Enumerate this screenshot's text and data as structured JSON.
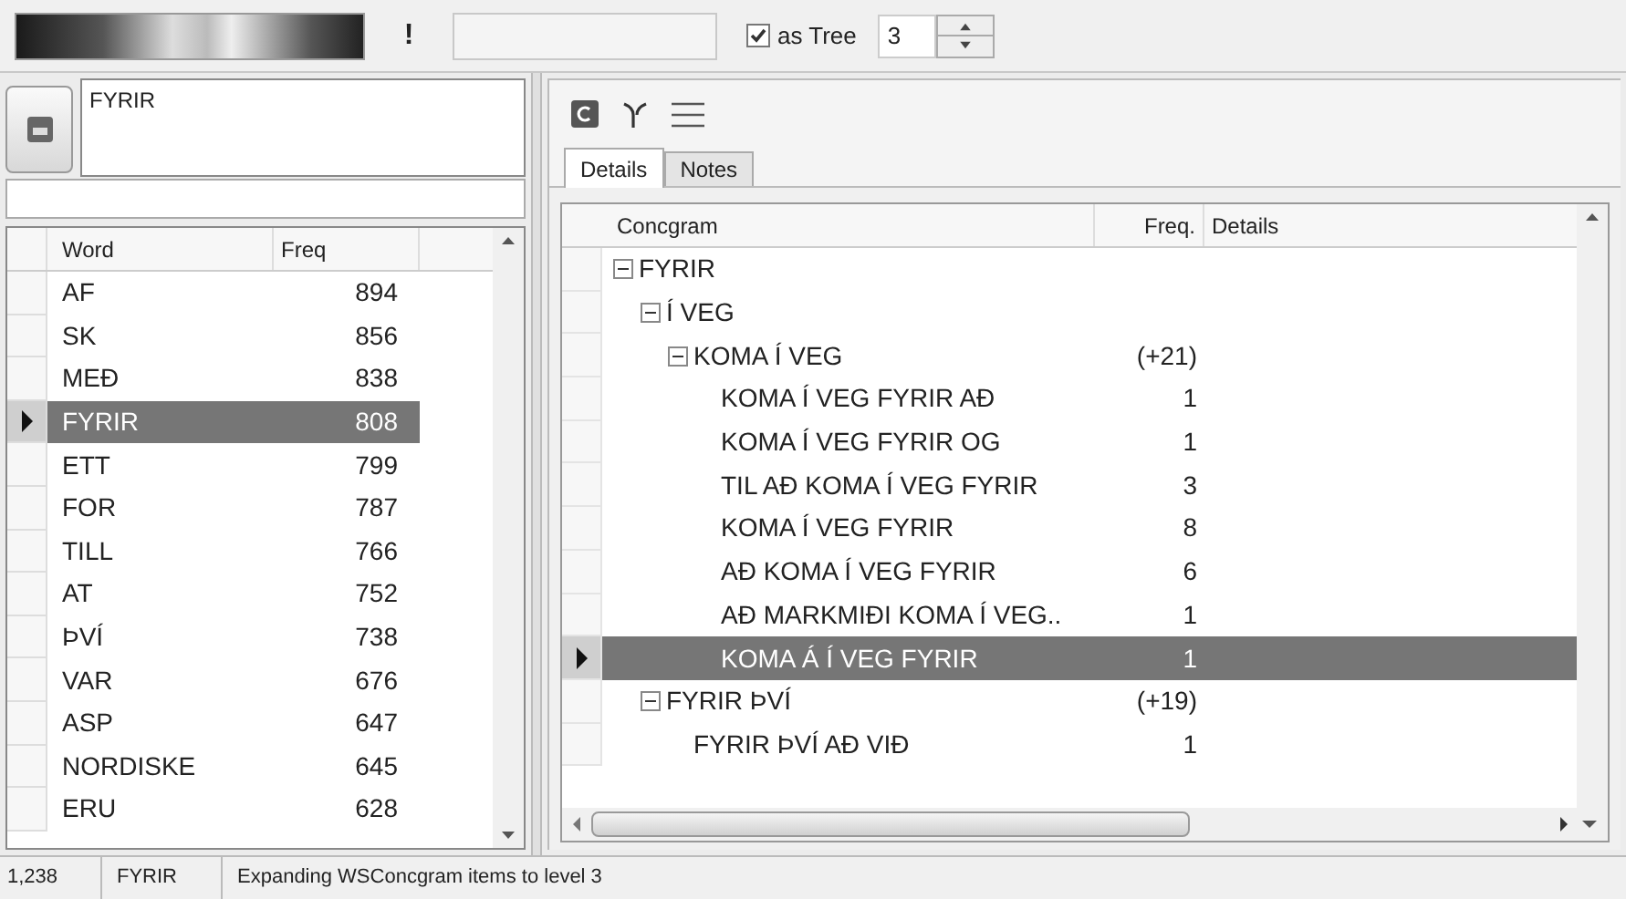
{
  "toolbar": {
    "alert": "!",
    "as_tree": {
      "label": "as Tree",
      "checked": true
    },
    "level": "3"
  },
  "query": {
    "text": "FYRIR"
  },
  "word_list": {
    "columns": [
      "Word",
      "Freq"
    ],
    "rows": [
      {
        "word": "AF",
        "freq": "894",
        "selected": false
      },
      {
        "word": "SK",
        "freq": "856",
        "selected": false
      },
      {
        "word": "MEÐ",
        "freq": "838",
        "selected": false
      },
      {
        "word": "FYRIR",
        "freq": "808",
        "selected": true
      },
      {
        "word": "ETT",
        "freq": "799",
        "selected": false
      },
      {
        "word": "FOR",
        "freq": "787",
        "selected": false
      },
      {
        "word": "TILL",
        "freq": "766",
        "selected": false
      },
      {
        "word": "AT",
        "freq": "752",
        "selected": false
      },
      {
        "word": "ÞVÍ",
        "freq": "738",
        "selected": false
      },
      {
        "word": "VAR",
        "freq": "676",
        "selected": false
      },
      {
        "word": "ASP",
        "freq": "647",
        "selected": false
      },
      {
        "word": "NORDISKE",
        "freq": "645",
        "selected": false
      },
      {
        "word": "ERU",
        "freq": "628",
        "selected": false
      }
    ]
  },
  "tabs": [
    {
      "label": "Details",
      "selected": true
    },
    {
      "label": "Notes",
      "selected": false
    }
  ],
  "tree": {
    "columns": [
      "Concgram",
      "Freq.",
      "Details"
    ],
    "nodes": [
      {
        "label": "FYRIR",
        "expanded": true,
        "selected": false,
        "children": [
          {
            "label": "Í VEG",
            "expanded": true,
            "selected": false,
            "children": [
              {
                "label": "KOMA Í VEG",
                "freq": "(+21)",
                "expanded": true,
                "selected": false,
                "children": [
                  {
                    "label": "KOMA Í VEG FYRIR AÐ",
                    "freq": "1",
                    "selected": false
                  },
                  {
                    "label": "KOMA Í VEG FYRIR OG",
                    "freq": "1",
                    "selected": false
                  },
                  {
                    "label": "TIL AÐ KOMA Í VEG FYRIR",
                    "freq": "3",
                    "selected": false
                  },
                  {
                    "label": "KOMA Í VEG FYRIR",
                    "freq": "8",
                    "selected": false
                  },
                  {
                    "label": "AÐ KOMA Í VEG FYRIR",
                    "freq": "6",
                    "selected": false
                  },
                  {
                    "label": "AÐ MARKMIÐI KOMA Í VEG..",
                    "freq": "1",
                    "selected": false
                  },
                  {
                    "label": "KOMA Á Í VEG FYRIR",
                    "freq": "1",
                    "selected": true
                  }
                ]
              }
            ]
          },
          {
            "label": "FYRIR ÞVÍ",
            "freq": "(+19)",
            "expanded": true,
            "selected": false,
            "children": [
              {
                "label": "FYRIR ÞVÍ AÐ VIÐ",
                "freq": "1",
                "selected": false
              }
            ]
          }
        ]
      }
    ]
  },
  "status_bar": [
    "1,238",
    "FYRIR",
    "Expanding WSConcgram items to level 3"
  ]
}
